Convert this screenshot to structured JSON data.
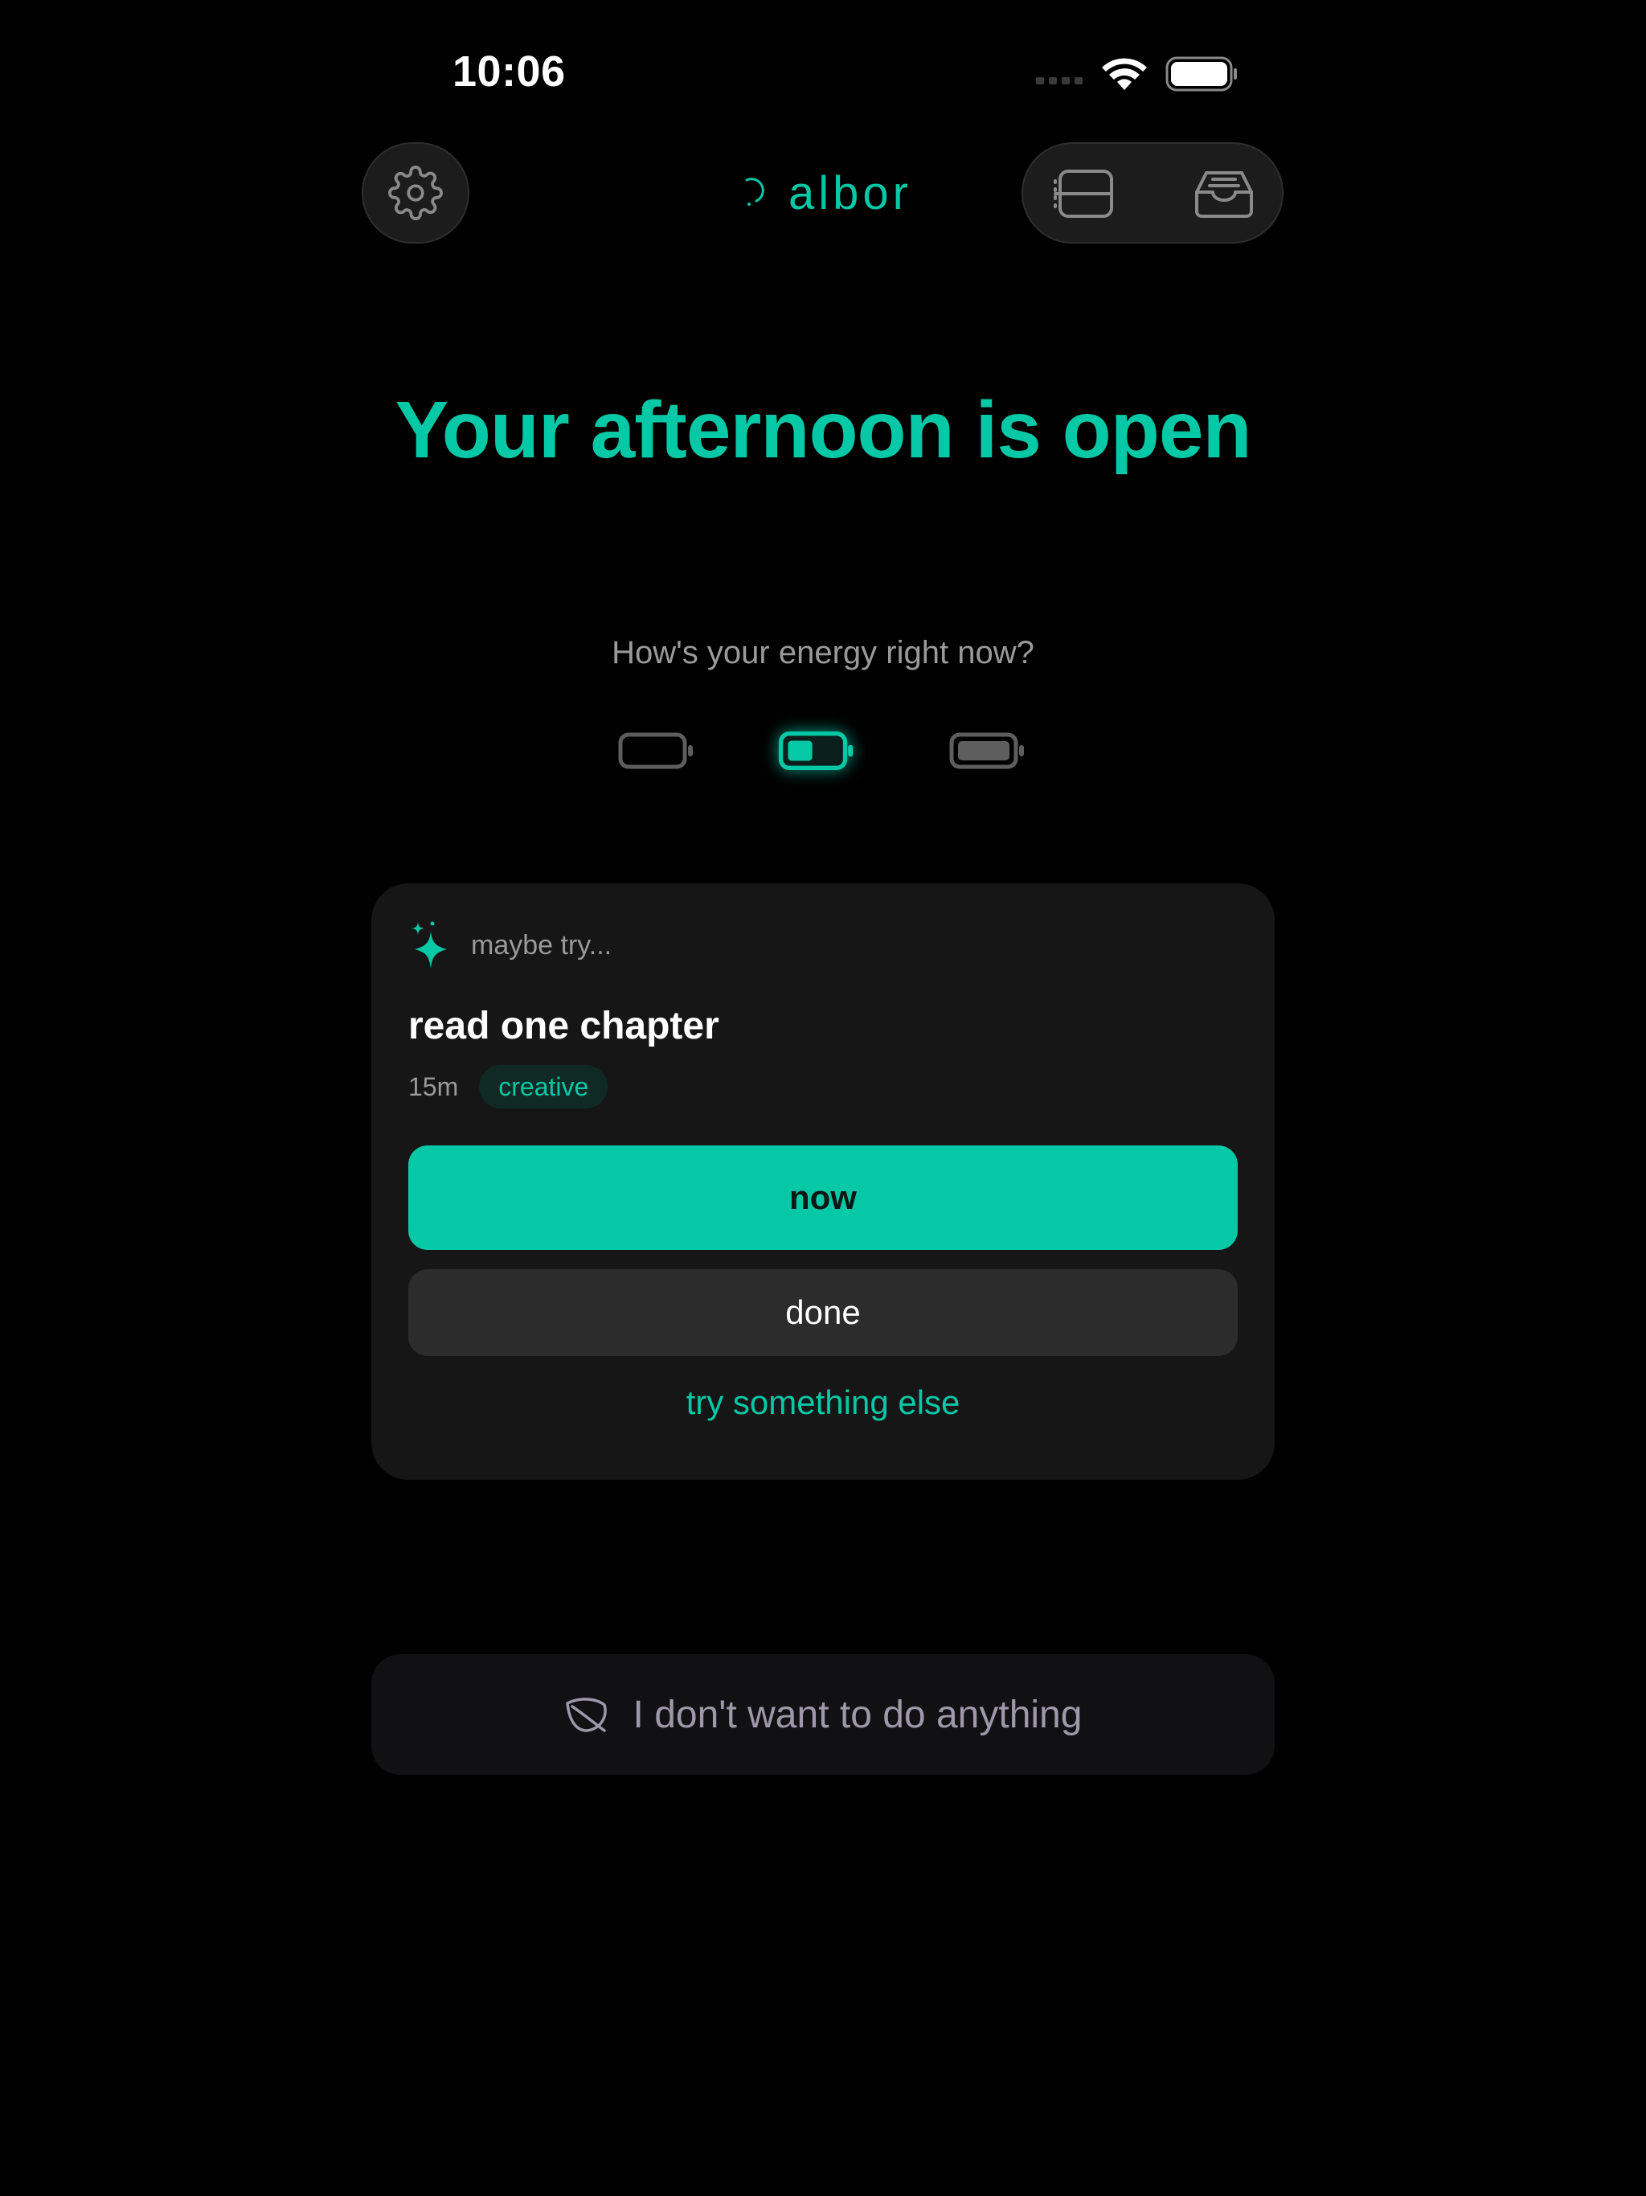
{
  "status_bar": {
    "time": "10:06"
  },
  "header": {
    "logo_text": "albor",
    "settings_icon": "gear-icon",
    "nav_icons": [
      "list-icon",
      "inbox-icon"
    ]
  },
  "main": {
    "headline": "Your afternoon is open",
    "energy_question": "How's your energy right now?",
    "energy_levels": [
      {
        "icon": "battery-empty-icon",
        "selected": false
      },
      {
        "icon": "battery-half-icon",
        "selected": true
      },
      {
        "icon": "battery-full-icon",
        "selected": false
      }
    ]
  },
  "suggestion": {
    "eyebrow": "maybe try...",
    "title": "read one chapter",
    "duration": "15m",
    "tag": "creative",
    "primary_label": "now",
    "secondary_label": "done",
    "alternate_label": "try something else"
  },
  "rest": {
    "label": "I don't want to do anything",
    "icon": "leaf-icon"
  },
  "colors": {
    "accent": "#05c8a6",
    "background": "#000000",
    "card": "#161616",
    "muted_text": "#9a9a9a"
  }
}
